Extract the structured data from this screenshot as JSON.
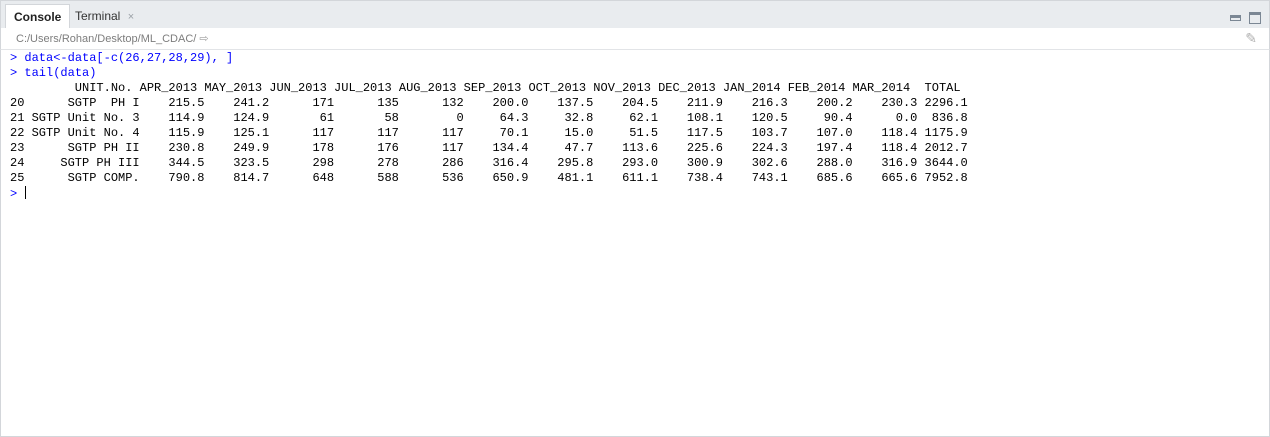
{
  "tabs": [
    {
      "label": "Console"
    },
    {
      "label": "Terminal",
      "close": "×"
    }
  ],
  "path": {
    "text": "C:/Users/Rohan/Desktop/ML_CDAC/",
    "arrow": "⇨"
  },
  "console": {
    "prompt": "> ",
    "commands": [
      "data<-data[-c(26,27,28,29), ]",
      "tail(data)"
    ],
    "output": [
      "         UNIT.No. APR_2013 MAY_2013 JUN_2013 JUL_2013 AUG_2013 SEP_2013 OCT_2013 NOV_2013 DEC_2013 JAN_2014 FEB_2014 MAR_2014  TOTAL",
      "20      SGTP  PH I    215.5    241.2      171      135      132    200.0    137.5    204.5    211.9    216.3    200.2    230.3 2296.1",
      "21 SGTP Unit No. 3    114.9    124.9       61       58        0     64.3     32.8     62.1    108.1    120.5     90.4      0.0  836.8",
      "22 SGTP Unit No. 4    115.9    125.1      117      117      117     70.1     15.0     51.5    117.5    103.7    107.0    118.4 1175.9",
      "23      SGTP PH II    230.8    249.9      178      176      117    134.4     47.7    113.6    225.6    224.3    197.4    118.4 2012.7",
      "24     SGTP PH III    344.5    323.5      298      278      286    316.4    295.8    293.0    300.9    302.6    288.0    316.9 3644.0",
      "25      SGTP COMP.    790.8    814.7      648      588      536    650.9    481.1    611.1    738.4    743.1    685.6    665.6 7952.8"
    ]
  }
}
